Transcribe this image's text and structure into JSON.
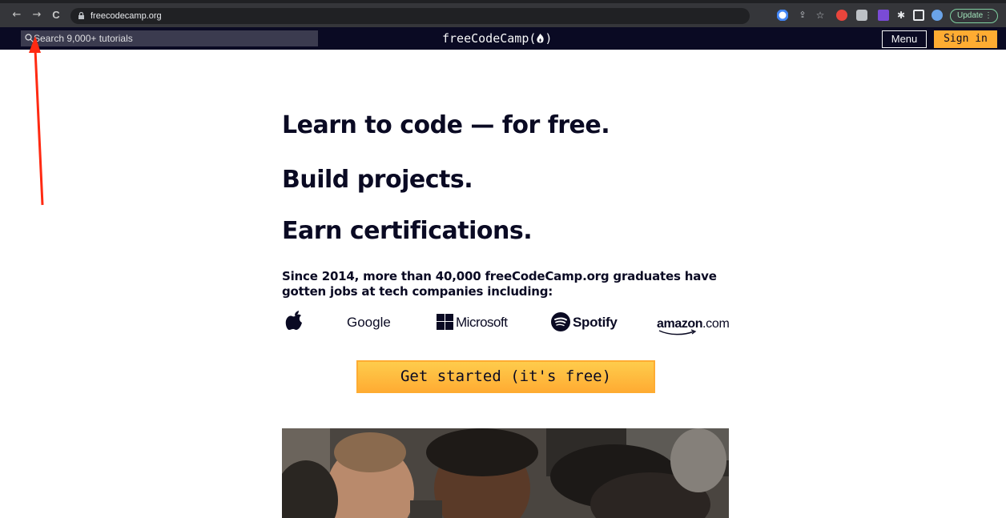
{
  "browser": {
    "url": "freecodecamp.org",
    "update_label": "Update",
    "menu_dots": "⋮",
    "back_glyph": "←",
    "forward_glyph": "→",
    "reload_glyph": "C"
  },
  "navbar": {
    "search_placeholder": "Search 9,000+ tutorials",
    "logo": "freeCodeCamp(🔥)",
    "menu_label": "Menu",
    "signin_label": "Sign in"
  },
  "hero": {
    "line1": "Learn to code — for free.",
    "line2": "Build projects.",
    "line3": "Earn certifications.",
    "subtext": "Since 2014, more than 40,000 freeCodeCamp.org graduates have gotten jobs at tech companies including:",
    "companies": [
      "Google",
      "Microsoft",
      "Spotify",
      "amazon",
      ".com"
    ],
    "cta_label": "Get started (it's free)"
  },
  "colors": {
    "navbar_bg": "#0a0a23",
    "accent": "#feac32",
    "annotation_arrow": "#ff2a12"
  }
}
